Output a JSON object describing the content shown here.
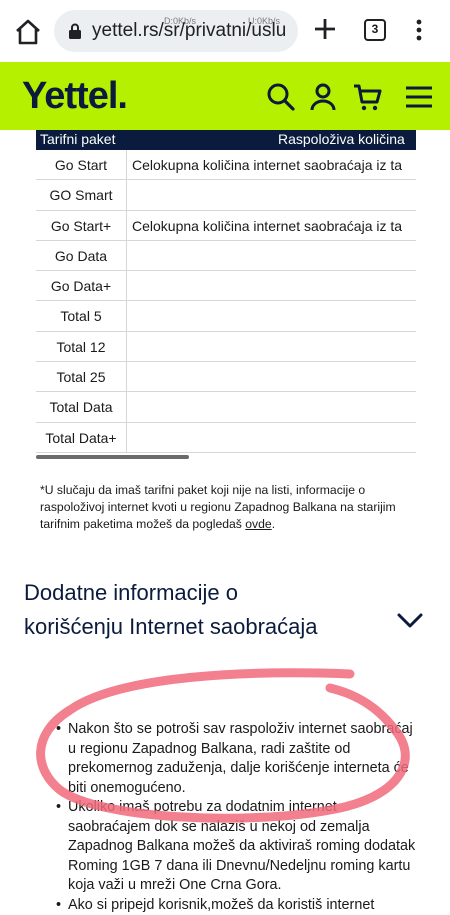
{
  "browser": {
    "url": "yettel.rs/sr/privatni/uslu",
    "speed_down": "D:0Kb/s",
    "speed_up": "U:0Kb/s",
    "tab_count": "3"
  },
  "header": {
    "logo": "Yettel.",
    "brand_color": "#b4f000",
    "dark_color": "#0a1b3d"
  },
  "table": {
    "col1_header": "Tarifni paket",
    "col2_header": "Raspoloživa količina",
    "rows": [
      {
        "name": "Go Start",
        "value": "Celokupna količina internet saobraćaja iz ta"
      },
      {
        "name": "GO Smart",
        "value": ""
      },
      {
        "name": "Go Start+",
        "value": "Celokupna količina internet saobraćaja iz ta"
      },
      {
        "name": "Go Data",
        "value": ""
      },
      {
        "name": "Go Data+",
        "value": ""
      },
      {
        "name": "Total 5",
        "value": ""
      },
      {
        "name": "Total 12",
        "value": ""
      },
      {
        "name": "Total 25",
        "value": ""
      },
      {
        "name": "Total Data",
        "value": ""
      },
      {
        "name": "Total Data+",
        "value": ""
      }
    ]
  },
  "footnote": {
    "text": "*U slučaju da imaš tarifni paket koji nije na listi, informacije o raspoloživoj internet kvoti u regionu Zapadnog Balkana na starijim tarifnim paketima možeš da pogledaš ",
    "link": "ovde",
    "end": "."
  },
  "accordion": {
    "title": "Dodatne informacije o korišćenju Internet saobraćaja"
  },
  "bullets": [
    "Nakon što se potroši sav raspoloživ internet saobraćaj u regionu Zapadnog Balkana, radi zaštite od prekomernog zaduženja, dalje korišćenje interneta će biti onemogućeno.",
    "Ukoliko imaš potrebu za dodatnim internet saobraćajem dok se nalaziš u nekoj od zemalja Zapadnog Balkana možeš da aktiviraš roming dodatak Roming 1GB 7 dana ili Dnevnu/Nedeljnu roming kartu koja važi u mreži One Crna Gora.",
    "Ako si pripejd korisnik,možeš da koristiš internet"
  ],
  "annotation_color": "#f06a7a"
}
